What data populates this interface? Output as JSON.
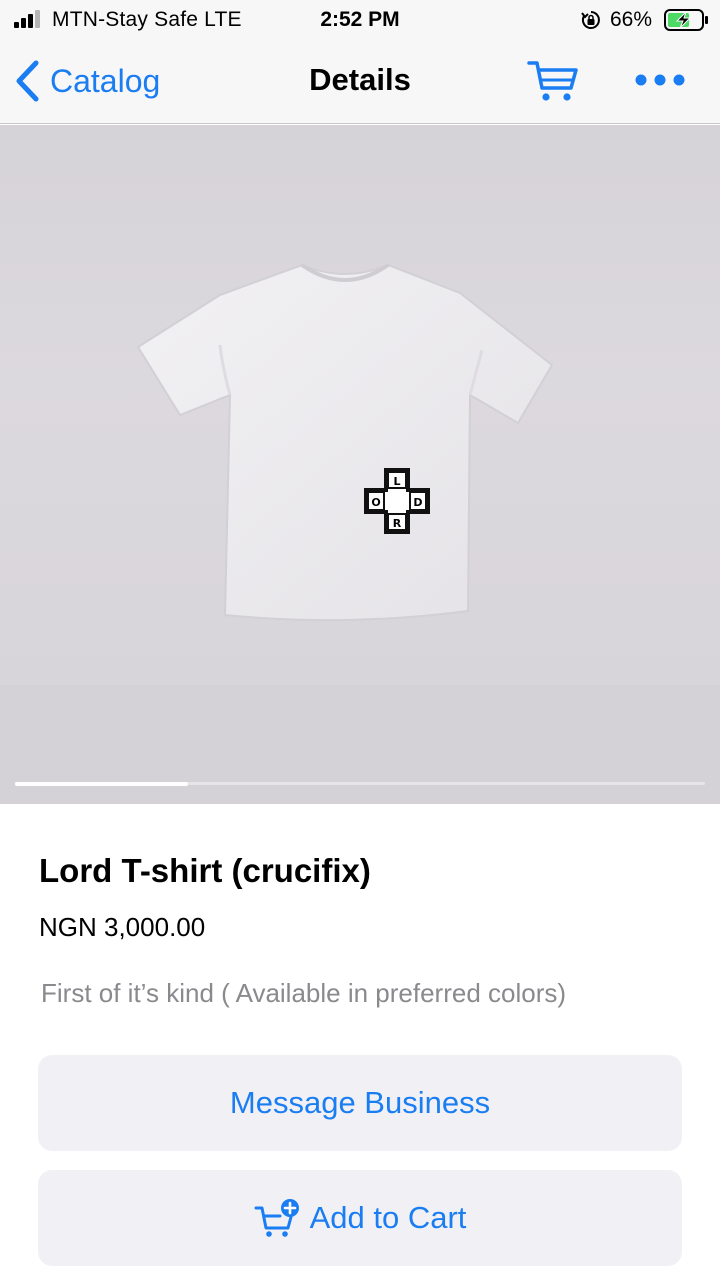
{
  "status_bar": {
    "carrier": "MTN-Stay Safe  LTE",
    "time": "2:52 PM",
    "battery_percent": "66%",
    "battery_level": 0.66,
    "signal_icon": "signal-bars-icon",
    "lock_icon": "orientation-lock-icon",
    "battery_icon": "battery-charging-icon"
  },
  "nav": {
    "back_label": "Catalog",
    "title": "Details",
    "cart_icon": "cart-icon",
    "more_icon": "more-icon"
  },
  "gallery": {
    "current_index_fraction": 0.25,
    "shirt_logo_letters": [
      "L",
      "O",
      "D",
      "R"
    ]
  },
  "product": {
    "name": "Lord T-shirt (crucifix)",
    "price": "NGN 3,000.00",
    "description": "First of it’s kind ( Available in preferred colors)"
  },
  "actions": {
    "message_label": "Message Business",
    "add_to_cart_label": "Add to Cart"
  },
  "colors": {
    "accent": "#1a7df2",
    "button_bg": "#f1f1f5",
    "bar_bg": "#f7f7f7",
    "secondary_text": "#8a8a8e"
  }
}
